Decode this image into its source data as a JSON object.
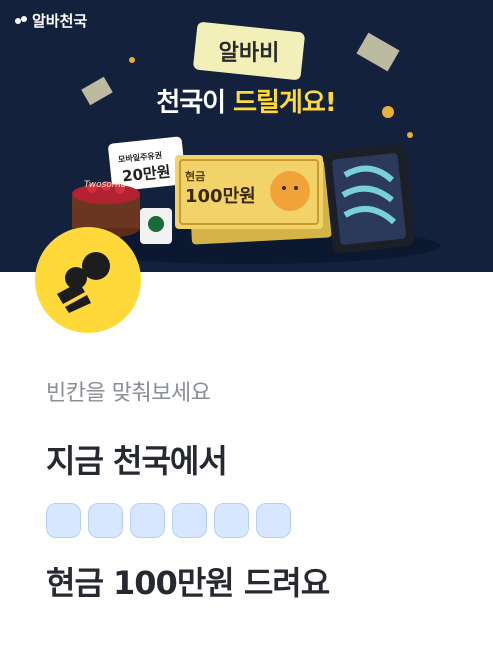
{
  "header": {
    "brand": "알바천국"
  },
  "hero": {
    "banner_label": "알바비",
    "headline_white": "천국이",
    "headline_yellow": "드릴게요!",
    "coupon_label": "모바일주유권",
    "coupon_amount": "20만원",
    "cash_label": "현금",
    "cash_amount": "100만원",
    "cake_label": "Twosome"
  },
  "quiz": {
    "subtitle": "빈칸을 맞춰보세요",
    "line1": "지금 천국에서",
    "blank_count": 6,
    "line2": "현금 100만원 드려요"
  },
  "colors": {
    "hero_bg": "#13213d",
    "accent_yellow": "#ffd83a",
    "blank_fill": "#d6e7ff"
  }
}
